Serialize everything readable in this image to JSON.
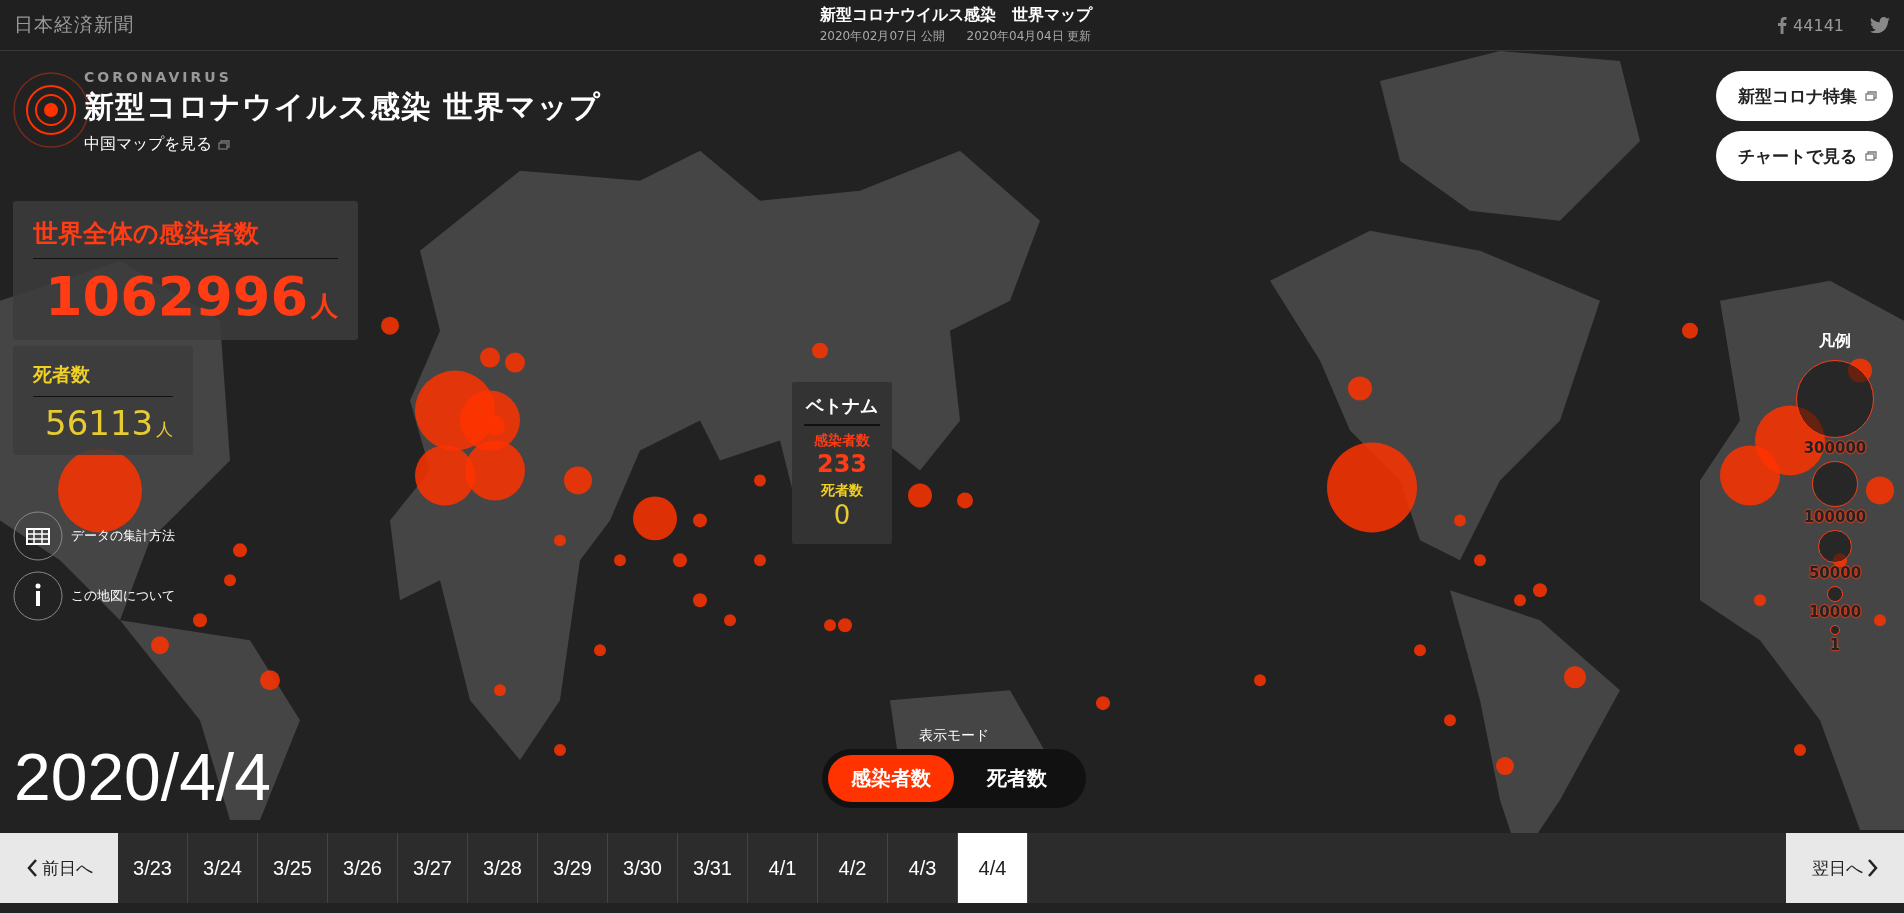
{
  "header": {
    "logo": "日本経済新聞",
    "title": "新型コロナウイルス感染　世界マップ",
    "published": "2020年02月07日 公開",
    "updated": "2020年04月04日 更新",
    "share_count": "44141"
  },
  "heading": {
    "kicker": "CORONAVIRUS",
    "title": "新型コロナウイルス感染 世界マップ",
    "link": "中国マップを見る"
  },
  "totals": [
    {
      "kind": "cases",
      "label": "世界全体の感染者数",
      "value": "1062996",
      "unit": "人"
    },
    {
      "kind": "deaths",
      "label": "死者数",
      "value": "56113",
      "unit": "人"
    }
  ],
  "info_links": [
    {
      "kind": "table",
      "label": "データの集計方法"
    },
    {
      "kind": "info",
      "label": "この地図について"
    }
  ],
  "top_buttons": [
    "新型コロナ特集",
    "チャートで見る"
  ],
  "tooltip": {
    "country": "ベトナム",
    "cases_label": "感染者数",
    "cases": "233",
    "deaths_label": "死者数",
    "deaths": "0"
  },
  "legend": {
    "title": "凡例",
    "items": [
      "300000",
      "100000",
      "50000",
      "10000",
      "1"
    ]
  },
  "mode": {
    "label": "表示モード",
    "options": [
      {
        "label": "感染者数",
        "selected": true
      },
      {
        "label": "死者数",
        "selected": false
      }
    ]
  },
  "current_date": "2020/4/4",
  "timeline": {
    "prev": "前日へ",
    "next": "翌日へ",
    "dates": [
      {
        "label": "3/23",
        "selected": false
      },
      {
        "label": "3/24",
        "selected": false
      },
      {
        "label": "3/25",
        "selected": false
      },
      {
        "label": "3/26",
        "selected": false
      },
      {
        "label": "3/27",
        "selected": false
      },
      {
        "label": "3/28",
        "selected": false
      },
      {
        "label": "3/29",
        "selected": false
      },
      {
        "label": "3/30",
        "selected": false
      },
      {
        "label": "3/31",
        "selected": false
      },
      {
        "label": "4/1",
        "selected": false
      },
      {
        "label": "4/2",
        "selected": false
      },
      {
        "label": "4/3",
        "selected": false
      },
      {
        "label": "4/4",
        "selected": true
      }
    ]
  }
}
